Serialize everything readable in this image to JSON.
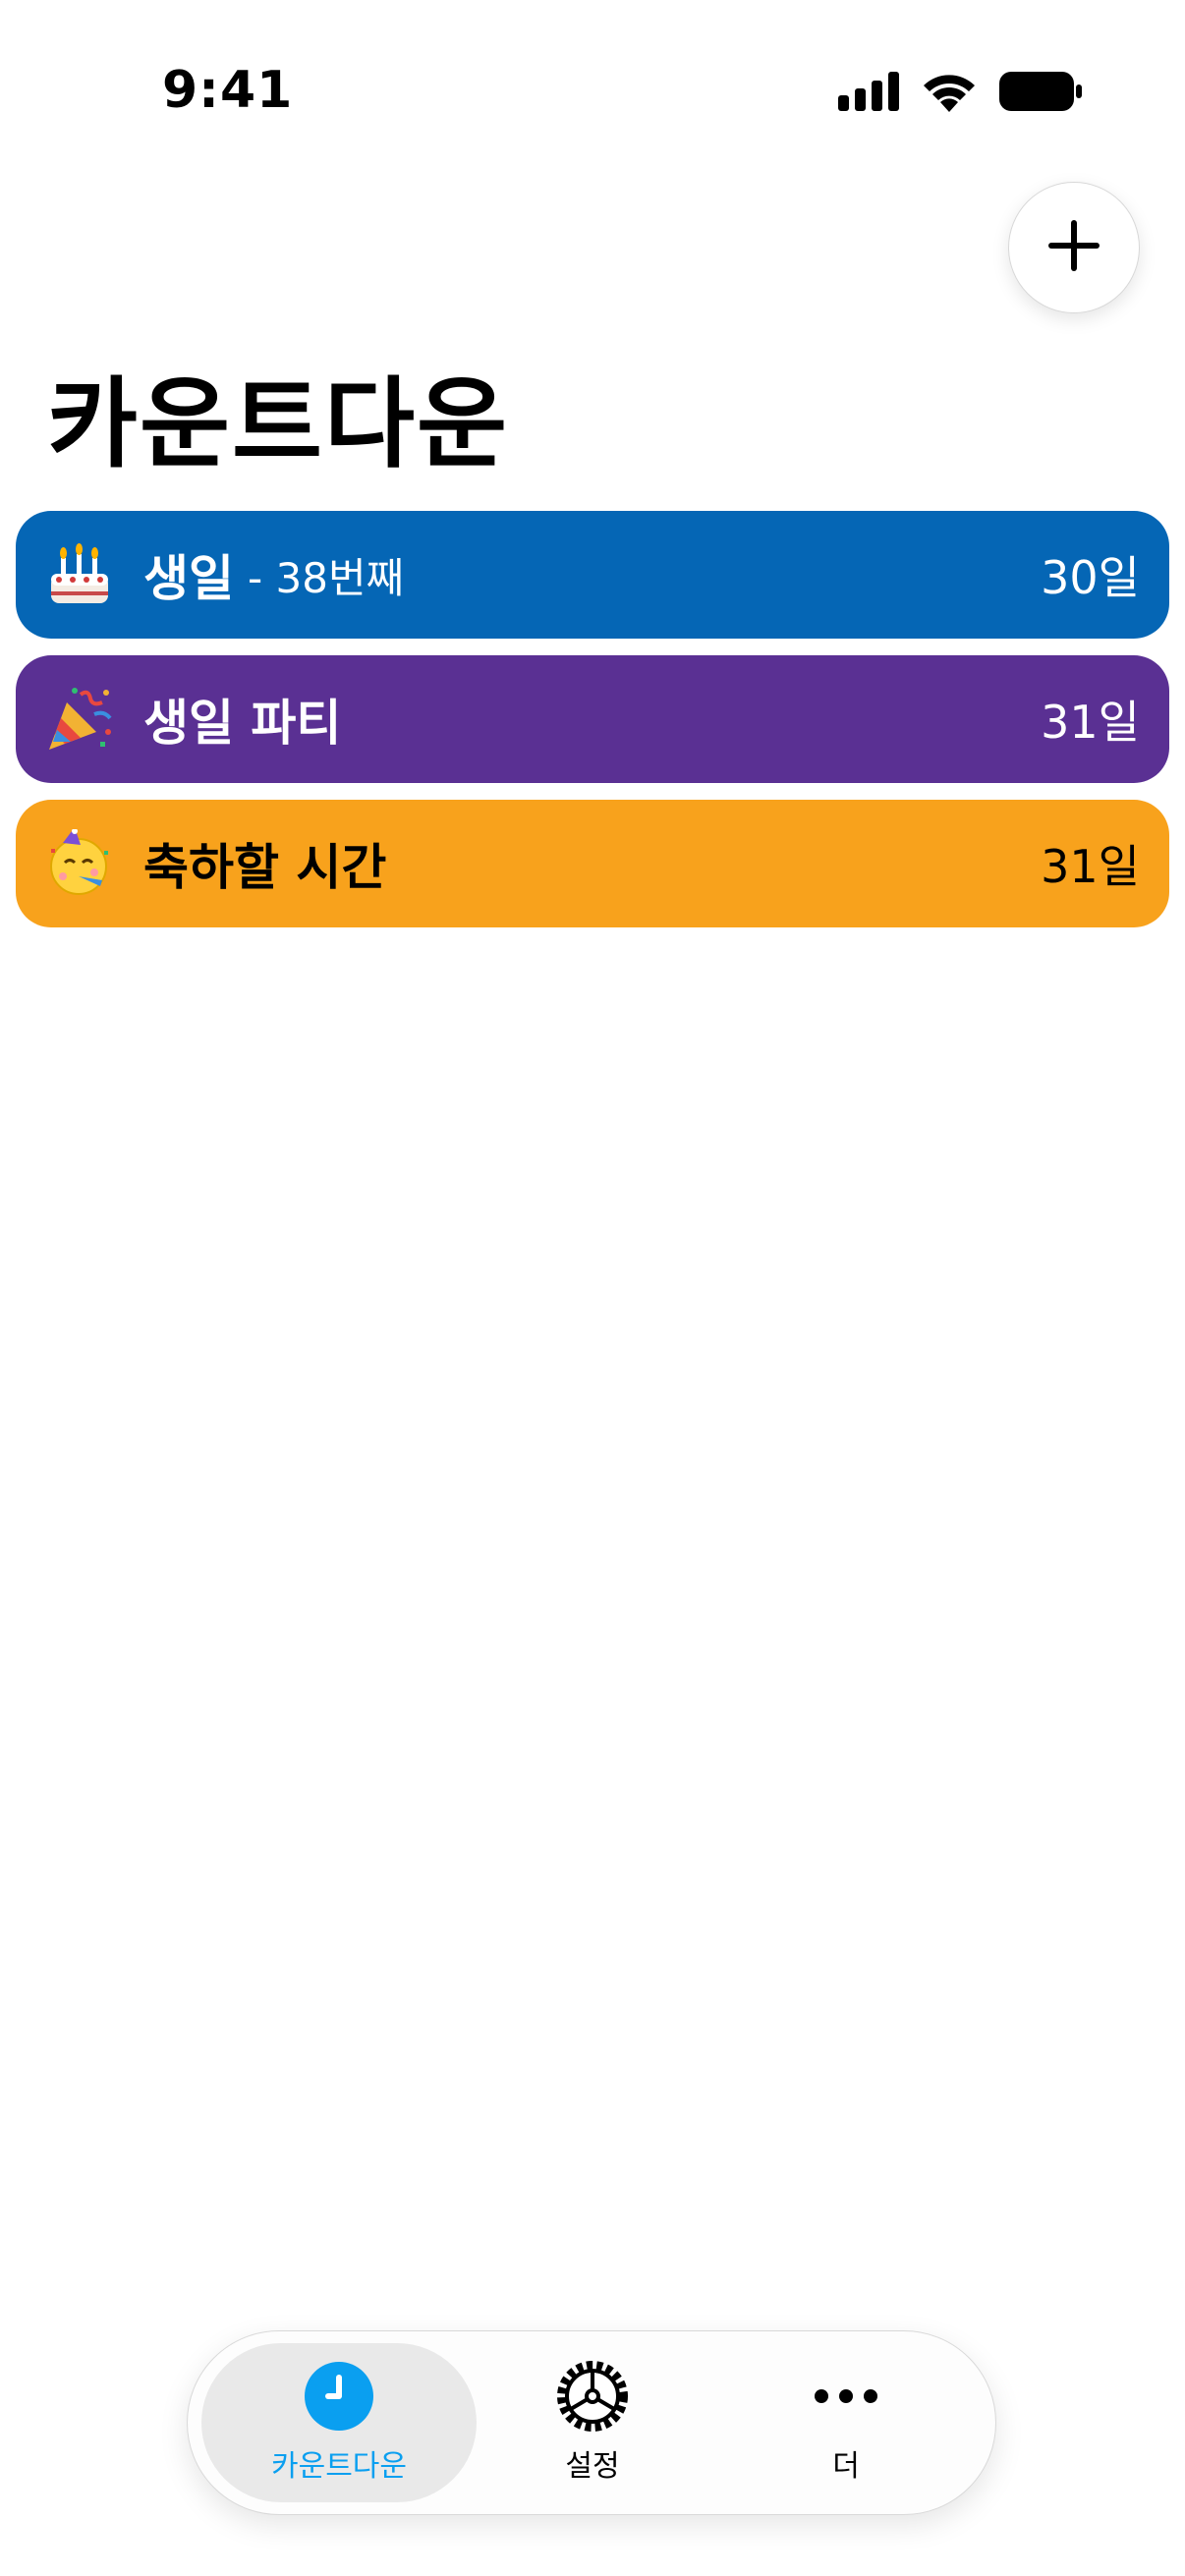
{
  "status_bar": {
    "time": "9:41",
    "icons": [
      "cellular-signal-icon",
      "wifi-icon",
      "battery-icon"
    ]
  },
  "header": {
    "add_button_icon": "plus-icon",
    "title": "카운트다운"
  },
  "countdowns": [
    {
      "emoji": "birthday-cake-icon",
      "title": "생일",
      "subtitle": "- 38번째",
      "days": "30일",
      "color": "#0566B5",
      "text_color": "#ffffff"
    },
    {
      "emoji": "party-popper-icon",
      "title": "생일 파티",
      "subtitle": "",
      "days": "31일",
      "color": "#5A3093",
      "text_color": "#ffffff"
    },
    {
      "emoji": "partying-face-icon",
      "title": "축하할 시간",
      "subtitle": "",
      "days": "31일",
      "color": "#F8A21C",
      "text_color": "#000000"
    }
  ],
  "tab_bar": {
    "tabs": [
      {
        "label": "카운트다운",
        "icon": "clock-icon",
        "active": true,
        "color": "#0A9FF0"
      },
      {
        "label": "설정",
        "icon": "gear-icon",
        "active": false,
        "color": "#000000"
      },
      {
        "label": "더",
        "icon": "more-icon",
        "active": false,
        "color": "#000000"
      }
    ]
  }
}
